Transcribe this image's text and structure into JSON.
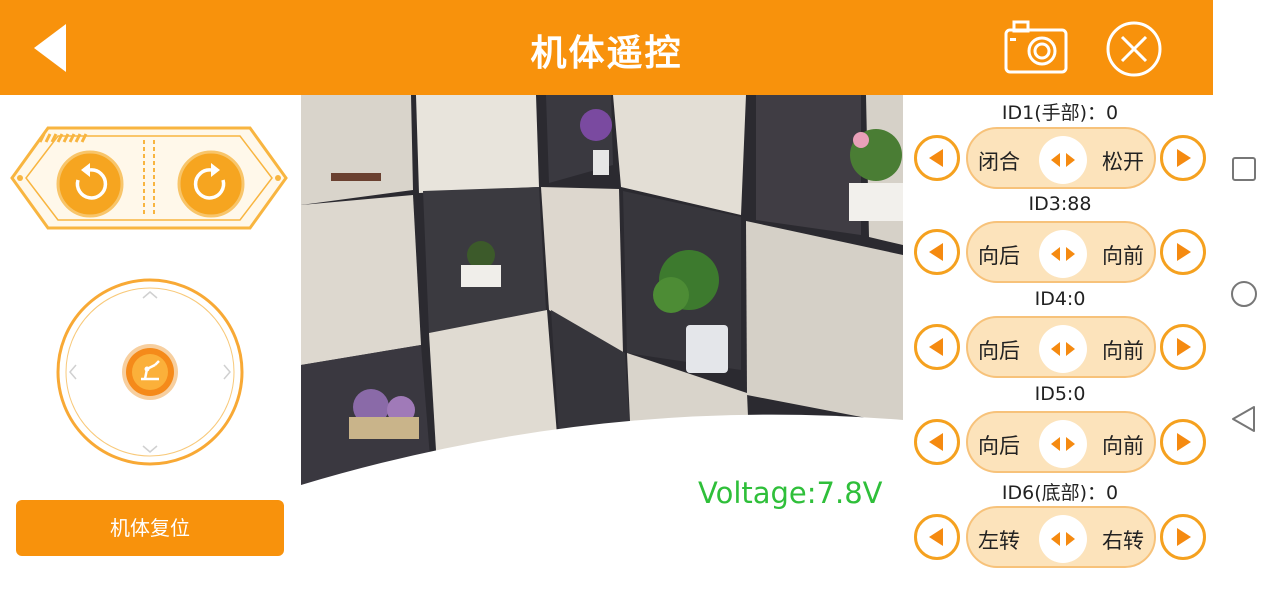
{
  "header": {
    "title": "机体遥控",
    "back_icon": "back-arrow-icon",
    "camera_icon": "camera-icon",
    "close_icon": "close-circle-icon"
  },
  "left_panel": {
    "rotate_left_icon": "rotate-counterclockwise-icon",
    "rotate_right_icon": "rotate-clockwise-icon",
    "joystick_icon": "robot-arm-icon",
    "reset_label": "机体复位"
  },
  "video": {
    "voltage_text": "Voltage:7.8V"
  },
  "servos": [
    {
      "label": "ID1(手部)：0",
      "left_action": "闭合",
      "right_action": "松开"
    },
    {
      "label": "ID3:88",
      "left_action": "向后",
      "right_action": "向前"
    },
    {
      "label": "ID4:0",
      "left_action": "向后",
      "right_action": "向前"
    },
    {
      "label": "ID5:0",
      "left_action": "向后",
      "right_action": "向前"
    },
    {
      "label": "ID6(底部)：0",
      "left_action": "左转",
      "right_action": "右转"
    }
  ],
  "system_nav": {
    "recent_icon": "square-recents-icon",
    "home_icon": "circle-home-icon",
    "back_icon": "triangle-back-icon"
  },
  "colors": {
    "accent": "#f8920c",
    "pill": "#fce3bb",
    "voltage": "#2fbf3a"
  }
}
